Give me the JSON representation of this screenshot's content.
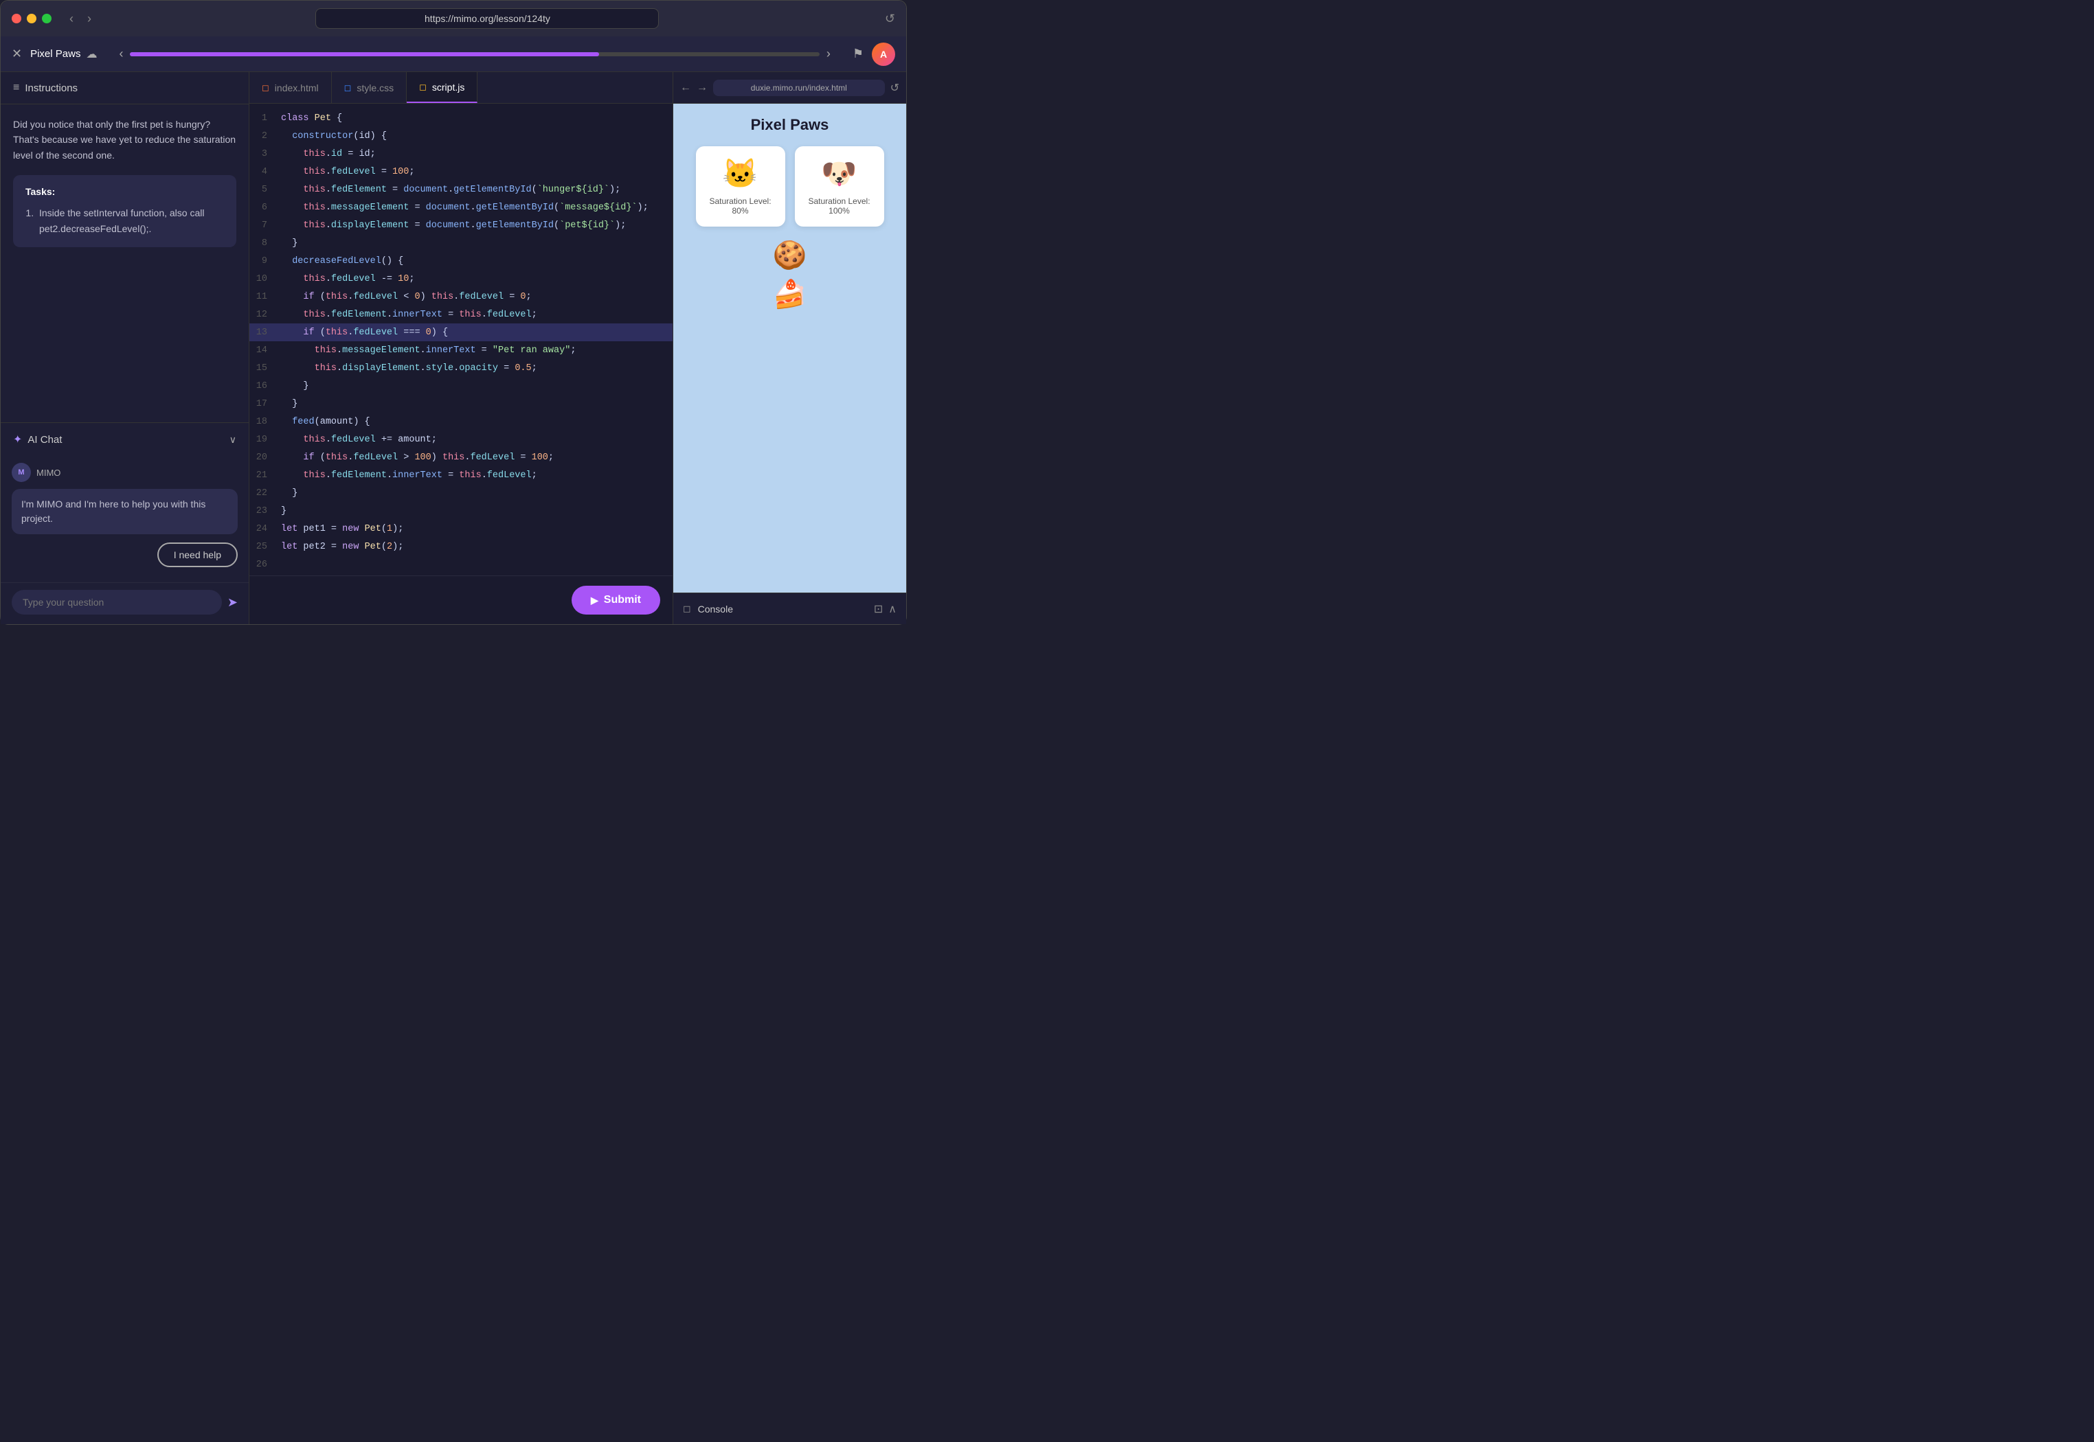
{
  "titlebar": {
    "url": "https://mimo.org/lesson/124ty"
  },
  "appheader": {
    "project_name": "Pixel Paws",
    "cloud_icon": "☁",
    "progress_percent": 68
  },
  "left_panel": {
    "instructions_title": "Instructions",
    "instructions_text": "Did you notice that only the first pet is hungry? That's because we have yet to reduce the saturation level of the second one.",
    "tasks_title": "Tasks:",
    "task_1": "Inside the setInterval function, also call pet2.decreaseFedLevel();."
  },
  "ai_chat": {
    "title": "AI Chat",
    "mimo_name": "MIMO",
    "mimo_message": "I'm MIMO and I'm here to help you with this project.",
    "help_btn": "I need help",
    "chat_placeholder": "Type your question"
  },
  "editor": {
    "tabs": [
      {
        "label": "index.html",
        "type": "html",
        "active": false
      },
      {
        "label": "style.css",
        "type": "css",
        "active": false
      },
      {
        "label": "script.js",
        "type": "js",
        "active": true
      }
    ],
    "submit_btn": "Submit"
  },
  "preview": {
    "url": "duxie.mimo.run/index.html",
    "title": "Pixel Paws",
    "pets": [
      {
        "emoji": "🐱",
        "saturation": "Saturation Level: 80%"
      },
      {
        "emoji": "🐶",
        "saturation": "Saturation Level: 100%"
      }
    ],
    "foods": [
      "🍪",
      "🍰"
    ],
    "console_title": "Console"
  }
}
